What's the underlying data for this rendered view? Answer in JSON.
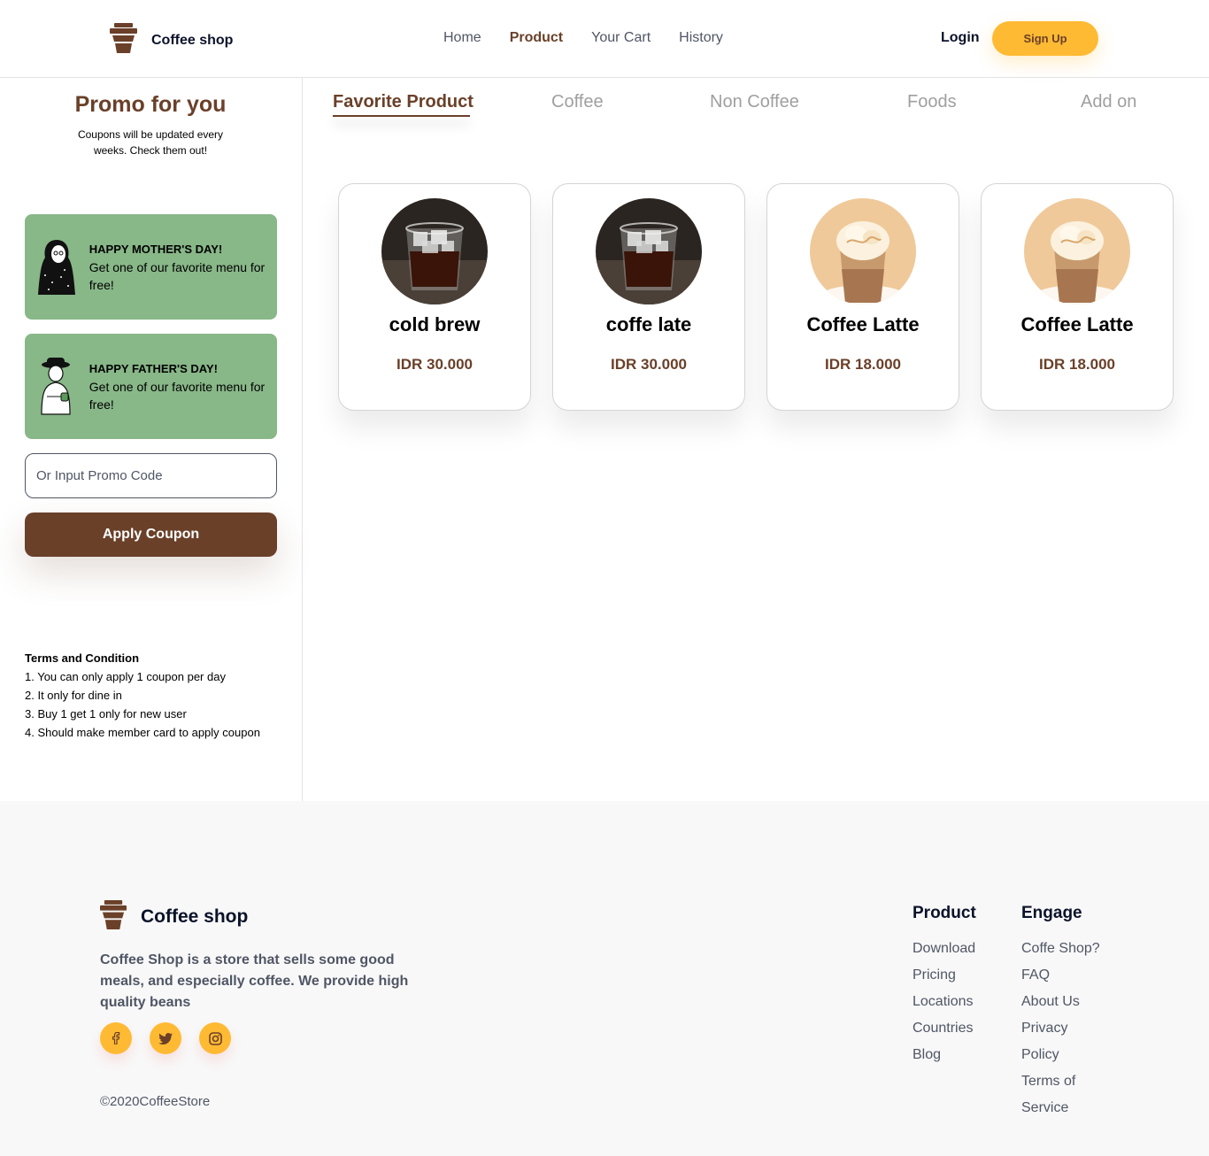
{
  "header": {
    "brand": "Coffee shop",
    "nav": [
      "Home",
      "Product",
      "Your Cart",
      "History"
    ],
    "active_nav": "Product",
    "login": "Login",
    "signup": "Sign Up"
  },
  "sidebar": {
    "title": "Promo for you",
    "subtitle": "Coupons will be updated every weeks. Check them out!",
    "coupons": [
      {
        "title": "HAPPY MOTHER'S DAY!",
        "text": "Get one of our favorite menu for free!"
      },
      {
        "title": "HAPPY FATHER'S DAY!",
        "text": "Get one of our favorite menu for free!"
      }
    ],
    "promo_placeholder": "Or Input Promo Code",
    "apply_label": "Apply Coupon",
    "terms_title": "Terms and Condition",
    "terms": [
      "1. You can only apply 1 coupon per day",
      "2. It only for dine in",
      "3. Buy 1 get 1 only for new user",
      "4. Should make member card to apply coupon"
    ]
  },
  "tabs": [
    "Favorite Product",
    "Coffee",
    "Non Coffee",
    "Foods",
    "Add on"
  ],
  "active_tab": "Favorite Product",
  "products": [
    {
      "name": "cold brew",
      "price": "IDR 30.000",
      "image": "iced-black-coffee"
    },
    {
      "name": "coffe late",
      "price": "IDR 30.000",
      "image": "iced-black-coffee"
    },
    {
      "name": "Coffee Latte",
      "price": "IDR 18.000",
      "image": "whipped-latte"
    },
    {
      "name": "Coffee Latte",
      "price": "IDR 18.000",
      "image": "whipped-latte"
    }
  ],
  "footer": {
    "brand": "Coffee shop",
    "description": "Coffee Shop is a store that sells some good meals, and especially coffee. We provide high quality beans",
    "socials": [
      "facebook-icon",
      "twitter-icon",
      "instagram-icon"
    ],
    "copyright": "©2020CoffeeStore",
    "columns": [
      {
        "title": "Product",
        "links": [
          "Download",
          "Pricing",
          "Locations",
          "Countries",
          "Blog"
        ]
      },
      {
        "title": "Engage",
        "links": [
          "Coffe Shop?",
          "FAQ",
          "About Us",
          "Privacy",
          "Policy",
          "Terms of",
          "Service"
        ]
      }
    ]
  },
  "colors": {
    "brown": "#6A4029",
    "yellow": "#FFBA33",
    "coupon_green": "#88B788",
    "footer_bg": "#F8F8F8"
  }
}
